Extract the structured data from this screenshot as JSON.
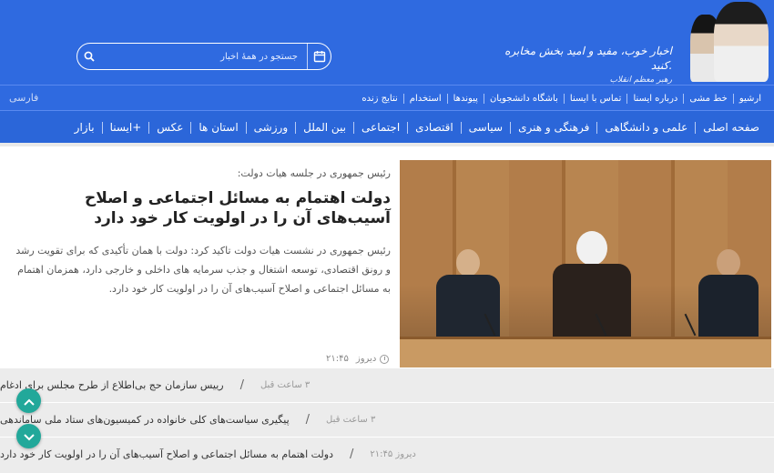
{
  "header": {
    "slogan_line1": "اخبار خوب، مفید و امید بخش مخابره کنید.",
    "slogan_signature": "رهبر معظم انقلاب",
    "search_placeholder": "جستجو در همهٔ اخبار",
    "bg_color": "#2f6ae0"
  },
  "toplinks": {
    "items": [
      "ارشیو",
      "خط مشی",
      "درباره ایسنا",
      "تماس با ایسنا",
      "باشگاه دانشجویان",
      "پیوندها",
      "استخدام",
      "نتایج زنده"
    ],
    "language": "فارسی"
  },
  "mainnav": {
    "items": [
      "صفحه اصلی",
      "علمی و دانشگاهی",
      "فرهنگی و هنری",
      "سیاسی",
      "اقتصادی",
      "اجتماعی",
      "بین الملل",
      "ورزشی",
      "استان ها",
      "عکس",
      "ایسنا+",
      "بازار"
    ]
  },
  "featured": {
    "kicker": "رئیس جمهوری در جلسه هیات دولت:",
    "headline": "دولت اهتمام به مسائل اجتماعی و اصلاح آسیب‌های آن را در اولویت کار خود دارد",
    "summary": "رئیس جمهوری در نشست هیات دولت تاکید کرد: دولت با همان تأکیدی که برای تقویت رشد و رونق اقتصادی، توسعه اشتغال و جذب سرمایه های داخلی و خارجی دارد، همزمان اهتمام به مسائل اجتماعی و اصلاح آسیب‌های آن را در اولویت کار خود دارد.",
    "time_day": "دیروز",
    "time_clock": "۲۱:۴۵"
  },
  "news": [
    {
      "title": "رییس سازمان حج بی‌اطلاع از طرح مجلس برای ادغام",
      "ago": "۳ ساعت قبل"
    },
    {
      "title": "پیگیری سیاست‌های کلی خانواده در کمیسیون‌های ستاد ملی ساماندهی",
      "ago": "۳ ساعت قبل"
    },
    {
      "title": "دولت اهتمام به مسائل اجتماعی و اصلاح آسیب‌های آن را در اولویت کار خود دارد",
      "ago": "دیروز ۲۱:۴۵"
    }
  ],
  "icons": {
    "calendar": "calendar-icon",
    "search": "search-icon",
    "clock": "clock-icon",
    "scroll_up": "chevron-up-icon",
    "scroll_down": "chevron-down-icon"
  },
  "colors": {
    "accent": "#2f6ae0",
    "fab": "#22a89a"
  }
}
